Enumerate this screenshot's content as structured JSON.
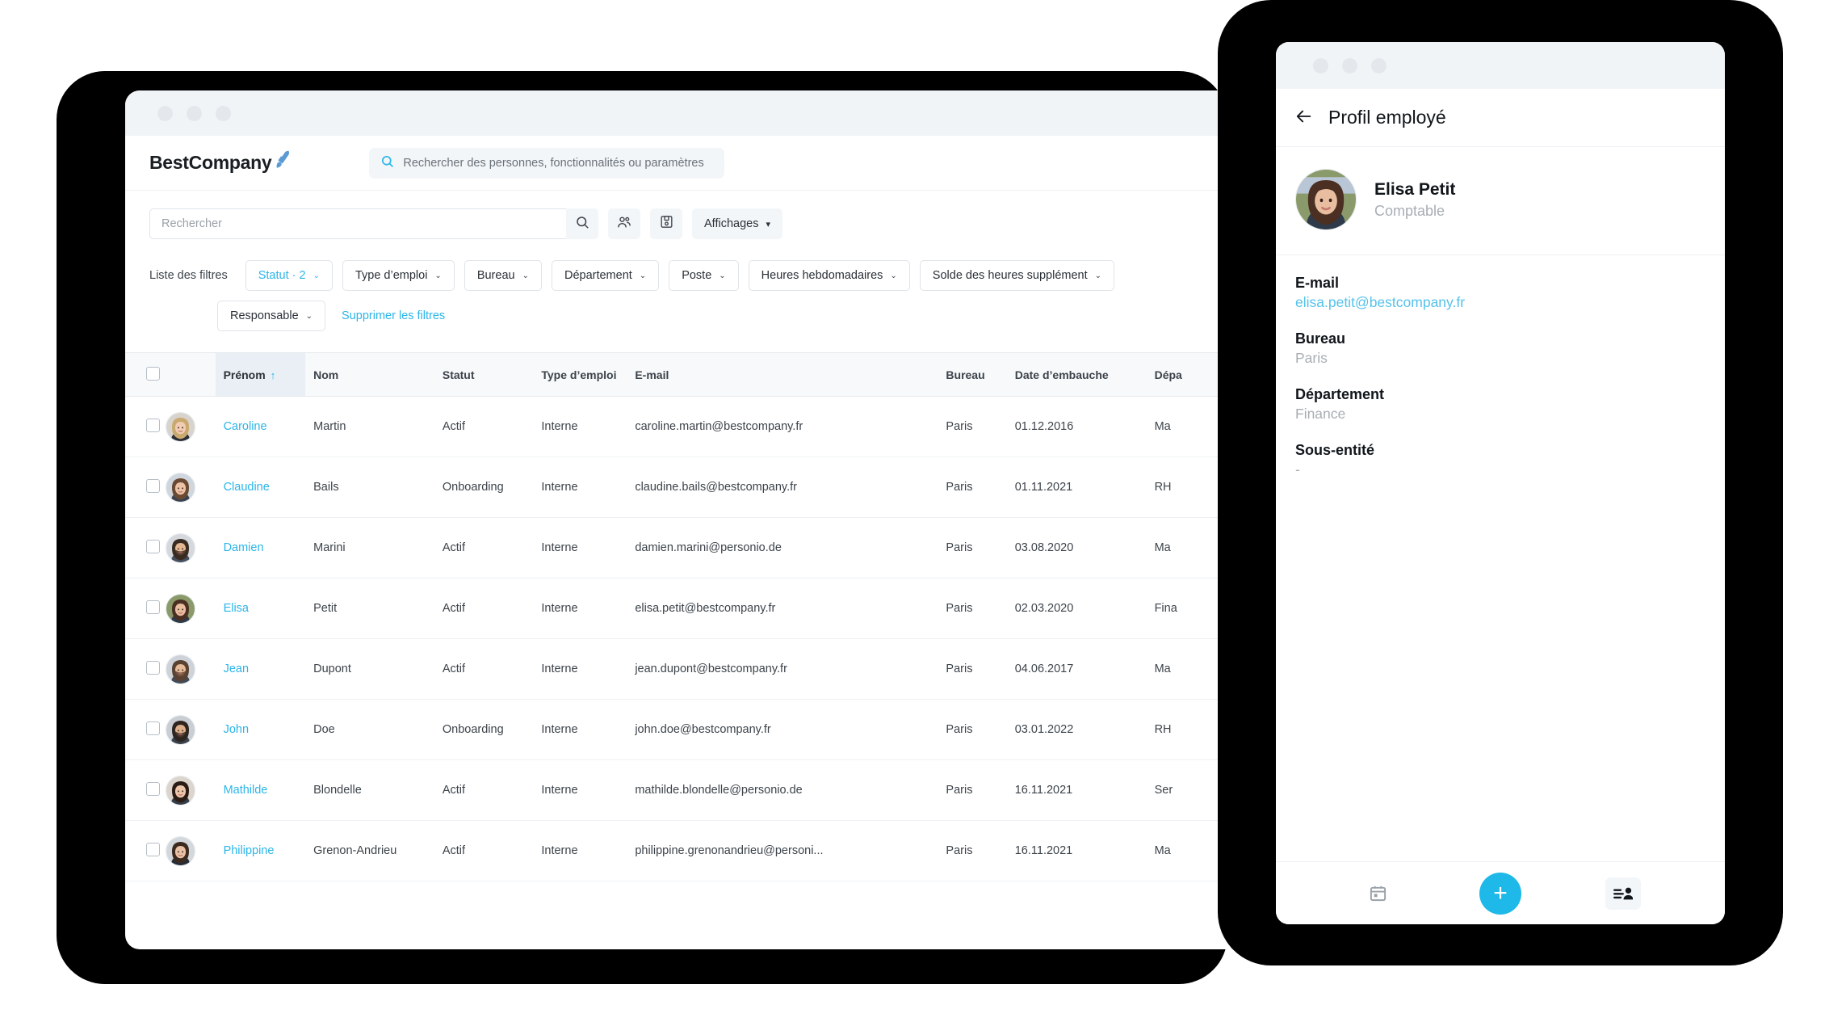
{
  "desktop": {
    "window_dots": 3,
    "header": {
      "brand": "BestCompany",
      "brand_icon": "rocket-icon",
      "global_search_placeholder": "Rechercher des personnes, fonctionnalités ou paramètres"
    },
    "toolbar": {
      "search_placeholder": "Rechercher",
      "search_icon": "search-icon",
      "people_icon": "people-group-icon",
      "save_icon": "save-floppy-icon",
      "views_label": "Affichages",
      "views_caret": "▾"
    },
    "filters": {
      "label": "Liste des filtres",
      "chips": [
        {
          "label": "Statut · 2",
          "active": true
        },
        {
          "label": "Type d’emploi",
          "active": false
        },
        {
          "label": "Bureau",
          "active": false
        },
        {
          "label": "Département",
          "active": false
        },
        {
          "label": "Poste",
          "active": false
        },
        {
          "label": "Heures hebdomadaires",
          "active": false
        },
        {
          "label": "Solde des heures supplément",
          "active": false
        }
      ],
      "chips_row2": [
        {
          "label": "Responsable",
          "active": false
        }
      ],
      "clear_label": "Supprimer les filtres",
      "caret": "⌄"
    },
    "table": {
      "columns": [
        {
          "key": "checkbox",
          "label": ""
        },
        {
          "key": "avatar",
          "label": ""
        },
        {
          "key": "first_name",
          "label": "Prénom",
          "sorted": true,
          "sort_dir": "↑"
        },
        {
          "key": "last_name",
          "label": "Nom"
        },
        {
          "key": "status",
          "label": "Statut"
        },
        {
          "key": "employment_type",
          "label": "Type d’emploi"
        },
        {
          "key": "email",
          "label": "E-mail"
        },
        {
          "key": "office",
          "label": "Bureau"
        },
        {
          "key": "hire_date",
          "label": "Date d’embauche"
        },
        {
          "key": "department",
          "label": "Dépa"
        }
      ],
      "rows": [
        {
          "first_name": "Caroline",
          "last_name": "Martin",
          "status": "Actif",
          "employment_type": "Interne",
          "email": "caroline.martin@bestcompany.fr",
          "office": "Paris",
          "hire_date": "01.12.2016",
          "department": "Ma"
        },
        {
          "first_name": "Claudine",
          "last_name": "Bails",
          "status": "Onboarding",
          "employment_type": "Interne",
          "email": "claudine.bails@bestcompany.fr",
          "office": "Paris",
          "hire_date": "01.11.2021",
          "department": "RH"
        },
        {
          "first_name": "Damien",
          "last_name": "Marini",
          "status": "Actif",
          "employment_type": "Interne",
          "email": "damien.marini@personio.de",
          "office": "Paris",
          "hire_date": "03.08.2020",
          "department": "Ma"
        },
        {
          "first_name": "Elisa",
          "last_name": "Petit",
          "status": "Actif",
          "employment_type": "Interne",
          "email": "elisa.petit@bestcompany.fr",
          "office": "Paris",
          "hire_date": "02.03.2020",
          "department": "Fina"
        },
        {
          "first_name": "Jean",
          "last_name": "Dupont",
          "status": "Actif",
          "employment_type": "Interne",
          "email": "jean.dupont@bestcompany.fr",
          "office": "Paris",
          "hire_date": "04.06.2017",
          "department": "Ma"
        },
        {
          "first_name": "John",
          "last_name": "Doe",
          "status": "Onboarding",
          "employment_type": "Interne",
          "email": "john.doe@bestcompany.fr",
          "office": "Paris",
          "hire_date": "03.01.2022",
          "department": "RH"
        },
        {
          "first_name": "Mathilde",
          "last_name": "Blondelle",
          "status": "Actif",
          "employment_type": "Interne",
          "email": "mathilde.blondelle@personio.de",
          "office": "Paris",
          "hire_date": "16.11.2021",
          "department": "Ser"
        },
        {
          "first_name": "Philippine",
          "last_name": "Grenon-Andrieu",
          "status": "Actif",
          "employment_type": "Interne",
          "email": "philippine.grenonandrieu@personi...",
          "office": "Paris",
          "hire_date": "16.11.2021",
          "department": "Ma"
        }
      ]
    }
  },
  "phone": {
    "window_dots": 3,
    "back_icon": "back-arrow-icon",
    "title": "Profil employé",
    "profile": {
      "name": "Elisa Petit",
      "role": "Comptable",
      "avatar": "employee-photo"
    },
    "fields": [
      {
        "label": "E-mail",
        "value": "elisa.petit@bestcompany.fr",
        "is_link": true
      },
      {
        "label": "Bureau",
        "value": "Paris",
        "is_link": false
      },
      {
        "label": "Département",
        "value": "Finance",
        "is_link": false
      },
      {
        "label": "Sous-entité",
        "value": "-",
        "is_link": false
      }
    ],
    "bottom_bar": {
      "calendar_icon": "calendar-icon",
      "add_label": "+",
      "add_icon": "plus-icon",
      "contacts_icon": "contact-list-icon"
    }
  },
  "colors": {
    "accent": "#2cb5e8",
    "fab": "#1eb9e8",
    "device": "#000000",
    "chrome": "#f1f4f7",
    "header_row": "#f7f9fb",
    "sorted_header": "#e9eff4",
    "text": "#3c434a"
  }
}
